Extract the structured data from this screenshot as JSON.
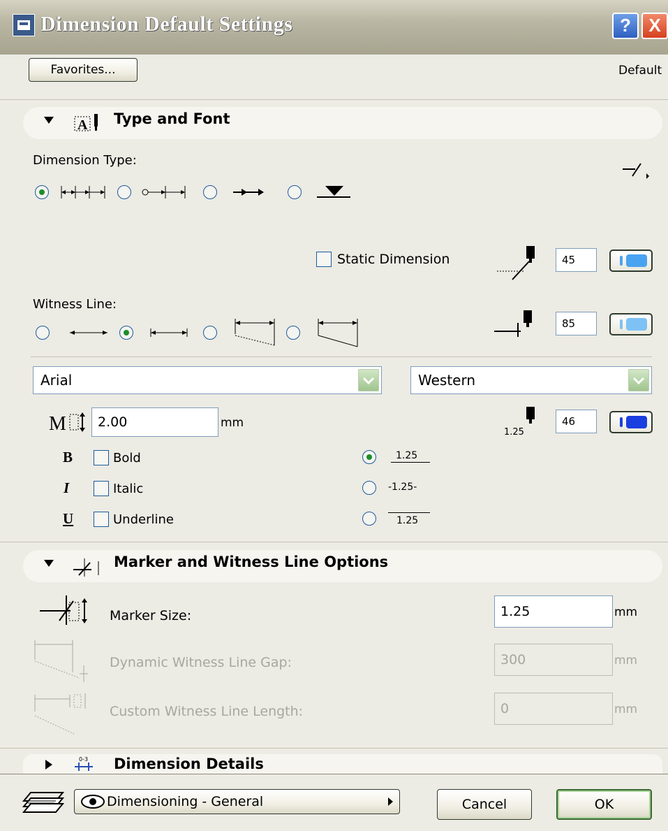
{
  "window": {
    "title": "Dimension Default Settings",
    "help_label": "?",
    "close_label": "X"
  },
  "toolbar": {
    "favorites_label": "Favorites...",
    "default_label": "Default"
  },
  "type_and_font": {
    "section_label": "Type and Font",
    "dimension_type_label": "Dimension Type:",
    "static_dimension_label": "Static Dimension",
    "pen_values": [
      "45",
      "85",
      "46"
    ],
    "pen_text_small": "1.25",
    "witness_line_label": "Witness Line:",
    "font_name": "Arial",
    "font_script": "Western",
    "text_height": "2.00",
    "text_height_unit": "mm",
    "style_icons": [
      "B",
      "I",
      "U"
    ],
    "styles": [
      "Bold",
      "Italic",
      "Underline"
    ],
    "placement_labels": [
      "1.25",
      "-1.25-",
      "1.25"
    ]
  },
  "marker": {
    "section_label": "Marker and Witness Line Options",
    "marker_size_label": "Marker Size:",
    "marker_size_value": "1.25",
    "dyn_gap_label": "Dynamic Witness Line Gap:",
    "dyn_gap_value": "300",
    "custom_len_label": "Custom Witness Line Length:",
    "custom_len_value": "0",
    "unit": "mm"
  },
  "details": {
    "section_label": "Dimension Details"
  },
  "footer": {
    "layer_label": "Dimensioning - General",
    "cancel_label": "Cancel",
    "ok_label": "OK"
  },
  "colors": {
    "accent_green": "#1a8e2a",
    "pen_blue_1": "#4aa3f0",
    "pen_blue_2": "#7ec2f5",
    "pen_blue_3": "#1a3fe0"
  }
}
